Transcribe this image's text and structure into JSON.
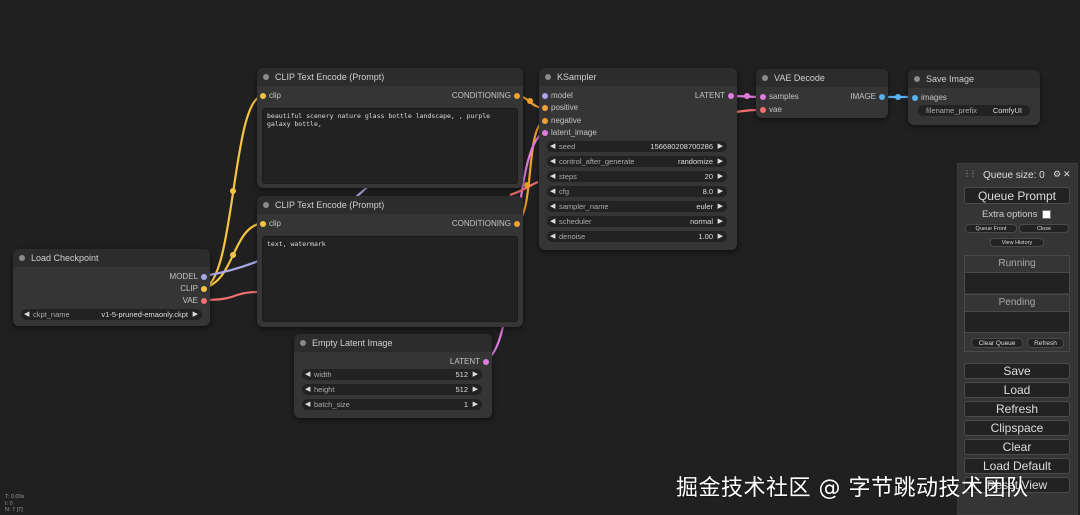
{
  "colors": {
    "clip": "#f5c542",
    "conditioning": "#f0a030",
    "model": "#a8a8e8",
    "vae": "#f07070",
    "latent": "#e07ce0",
    "image": "#5ab2f0"
  },
  "nodes": {
    "clip_top": {
      "title": "CLIP Text Encode (Prompt)",
      "input": "clip",
      "output": "CONDITIONING",
      "text": "beautiful scenery nature glass bottle landscape, , purple galaxy bottle,"
    },
    "clip_bottom": {
      "title": "CLIP Text Encode (Prompt)",
      "input": "clip",
      "output": "CONDITIONING",
      "text": "text, watermark"
    },
    "ksampler": {
      "title": "KSampler",
      "inputs": [
        "model",
        "positive",
        "negative",
        "latent_image"
      ],
      "output": "LATENT",
      "widgets": [
        {
          "name": "seed",
          "value": "156680208700286"
        },
        {
          "name": "control_after_generate",
          "value": "randomize"
        },
        {
          "name": "steps",
          "value": "20"
        },
        {
          "name": "cfg",
          "value": "8.0"
        },
        {
          "name": "sampler_name",
          "value": "euler"
        },
        {
          "name": "scheduler",
          "value": "normal"
        },
        {
          "name": "denoise",
          "value": "1.00"
        }
      ]
    },
    "vae_decode": {
      "title": "VAE Decode",
      "inputs": [
        "samples",
        "vae"
      ],
      "output": "IMAGE"
    },
    "save_image": {
      "title": "Save Image",
      "input": "images",
      "widget": {
        "name": "filename_prefix",
        "value": "ComfyUI"
      }
    },
    "load_checkpoint": {
      "title": "Load Checkpoint",
      "outputs": [
        "MODEL",
        "CLIP",
        "VAE"
      ],
      "widget": {
        "name": "ckpt_name",
        "value": "v1-5-pruned-emaonly.ckpt"
      }
    },
    "empty_latent": {
      "title": "Empty Latent Image",
      "output": "LATENT",
      "widgets": [
        {
          "name": "width",
          "value": "512"
        },
        {
          "name": "height",
          "value": "512"
        },
        {
          "name": "batch_size",
          "value": "1"
        }
      ]
    }
  },
  "panel": {
    "queue_size": "Queue size: 0",
    "queue_prompt": "Queue Prompt",
    "extra_options": "Extra options",
    "queue_front": "Queue Front",
    "close": "Close",
    "view_history": "View History",
    "running": "Running",
    "pending": "Pending",
    "clear_queue": "Clear Queue",
    "refresh_small": "Refresh",
    "save": "Save",
    "load": "Load",
    "refresh": "Refresh",
    "clipspace": "Clipspace",
    "clear": "Clear",
    "load_default": "Load Default",
    "reset_view": "Reset View",
    "gear_glyph": "⚙",
    "close_glyph": "✕",
    "drag_glyph": "⋮⋮"
  },
  "stats": [
    "T: 0.00s",
    "I: 0",
    "N: 7 [7]"
  ],
  "watermark": "掘金技术社区 @ 字节跳动技术团队"
}
